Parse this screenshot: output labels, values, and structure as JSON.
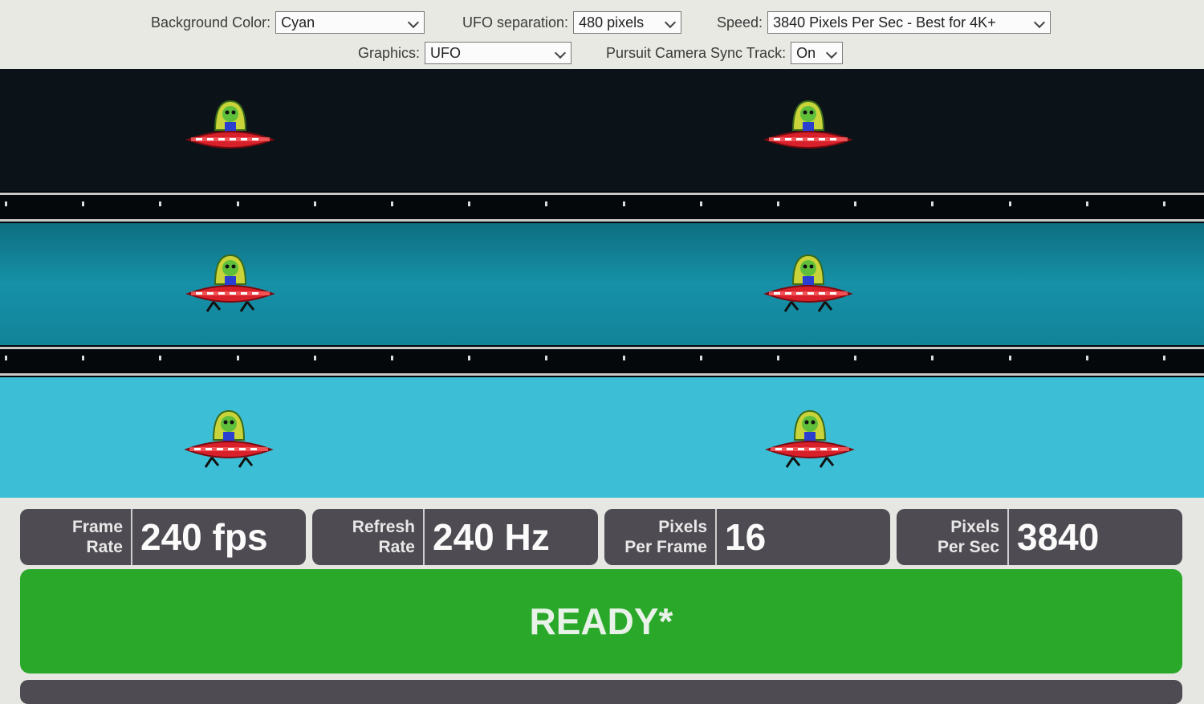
{
  "controls": {
    "background_color": {
      "label": "Background Color:",
      "value": "Cyan"
    },
    "ufo_separation": {
      "label": "UFO separation:",
      "value": "480 pixels"
    },
    "speed": {
      "label": "Speed:",
      "value": "3840 Pixels Per Sec - Best for 4K+"
    },
    "graphics": {
      "label": "Graphics:",
      "value": "UFO"
    },
    "pursuit_camera": {
      "label": "Pursuit Camera Sync Track:",
      "value": "On"
    }
  },
  "lanes": [
    {
      "name": "dark",
      "color": "#0c1318"
    },
    {
      "name": "teal",
      "color": "#1691a8"
    },
    {
      "name": "cyan",
      "color": "#3cbfd6"
    }
  ],
  "stats": [
    {
      "key_line1": "Frame",
      "key_line2": "Rate",
      "value": "240 fps"
    },
    {
      "key_line1": "Refresh",
      "key_line2": "Rate",
      "value": "240 Hz"
    },
    {
      "key_line1": "Pixels",
      "key_line2": "Per Frame",
      "value": "16"
    },
    {
      "key_line1": "Pixels",
      "key_line2": "Per Sec",
      "value": "3840"
    }
  ],
  "status": {
    "text": "READY*",
    "color": "#2aa82a"
  },
  "icons": [
    "chevron-down-icon",
    "ufo-icon"
  ]
}
